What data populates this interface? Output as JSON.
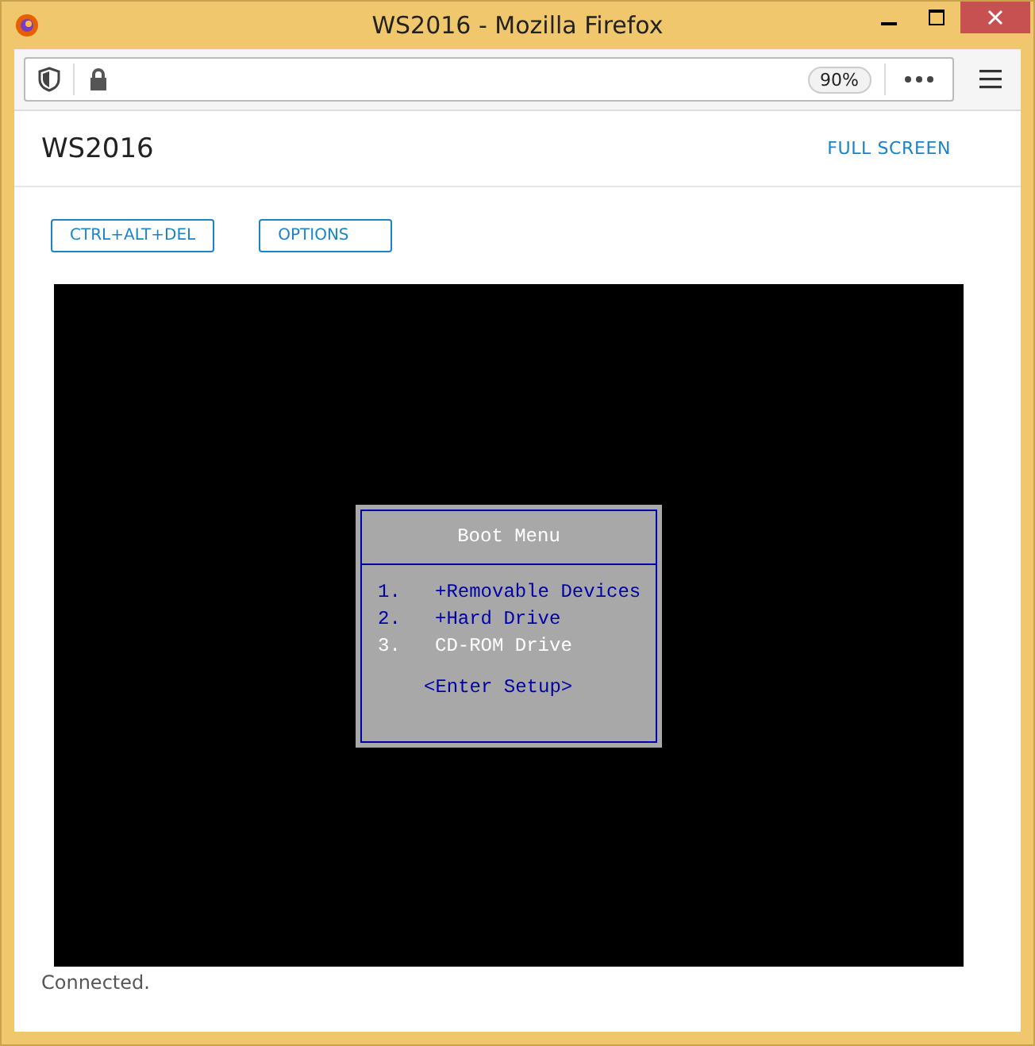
{
  "window": {
    "title": "WS2016 - Mozilla Firefox"
  },
  "toolbar": {
    "zoom": "90%"
  },
  "header": {
    "title": "WS2016",
    "full_screen": "FULL SCREEN"
  },
  "buttons": [
    "CTRL+ALT+DEL",
    "OPTIONS"
  ],
  "boot_menu": {
    "title": "Boot Menu",
    "items": [
      {
        "number": "1.",
        "label": "+Removable Devices",
        "selected": false
      },
      {
        "number": "2.",
        "label": "+Hard Drive",
        "selected": false
      },
      {
        "number": "3.",
        "label": "CD-ROM Drive",
        "selected": true
      }
    ],
    "setup": "<Enter Setup>"
  },
  "status": "Connected."
}
